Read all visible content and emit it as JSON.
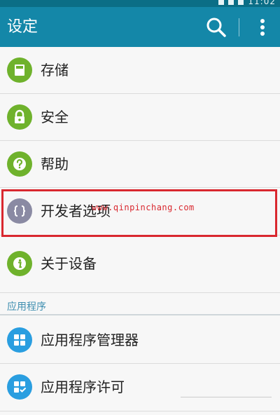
{
  "status_bar": {
    "time": "11:02"
  },
  "action_bar": {
    "title": "设定",
    "search_icon": "search-icon",
    "more_icon": "more-vert-icon"
  },
  "items": [
    {
      "label": "存储",
      "icon": "storage-icon",
      "color": "#6fb22c"
    },
    {
      "label": "安全",
      "icon": "lock-icon",
      "color": "#6fb22c"
    },
    {
      "label": "帮助",
      "icon": "help-icon",
      "color": "#6fb22c"
    },
    {
      "label": "开发者选项",
      "icon": "developer-braces-icon",
      "color": "#8a8aa3"
    },
    {
      "label": "关于设备",
      "icon": "info-icon",
      "color": "#6fb22c"
    }
  ],
  "section": {
    "title": "应用程序"
  },
  "app_items": [
    {
      "label": "应用程序管理器",
      "icon": "apps-grid-icon",
      "color": "#2a9ee0"
    },
    {
      "label": "应用程序许可",
      "icon": "app-permission-icon",
      "color": "#2a9ee0"
    }
  ],
  "watermark": "www.qinpinchang.com",
  "colors": {
    "action_bar": "#1487a8",
    "status_bar": "#0b6e86",
    "highlight": "#d9282f",
    "section_text": "#3f8fb0"
  }
}
